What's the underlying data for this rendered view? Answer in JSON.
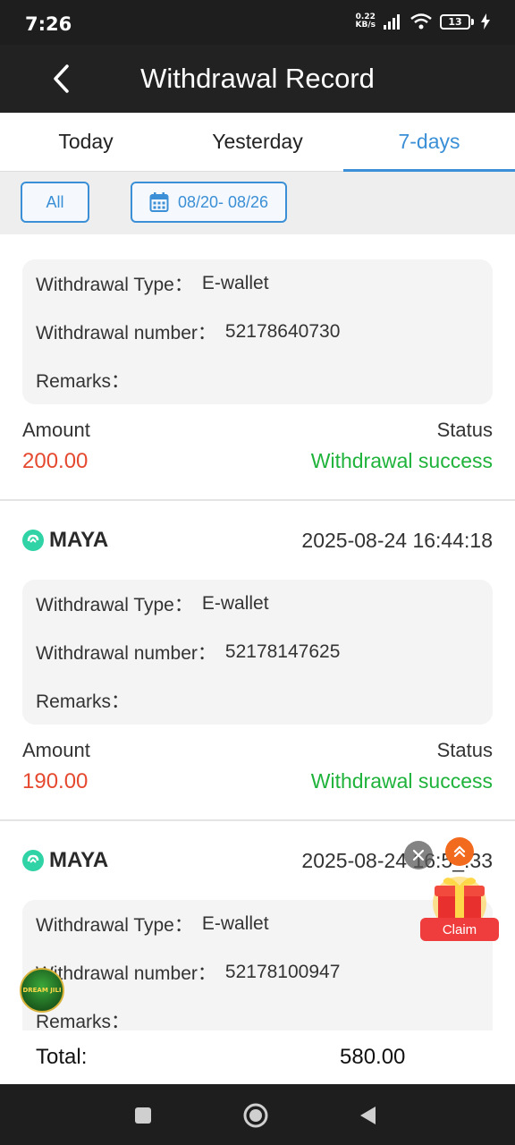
{
  "status_bar": {
    "time": "7:26",
    "net_speed_value": "0.22",
    "net_speed_unit": "KB/s",
    "battery": "13"
  },
  "header": {
    "title": "Withdrawal Record"
  },
  "tabs": [
    {
      "label": "Today",
      "active": false
    },
    {
      "label": "Yesterday",
      "active": false
    },
    {
      "label": "7-days",
      "active": true
    }
  ],
  "filter": {
    "all_label": "All",
    "date_range": "08/20- 08/26"
  },
  "labels": {
    "withdrawal_type": "Withdrawal Type：",
    "withdrawal_number": "Withdrawal number：",
    "remarks": "Remarks：",
    "amount": "Amount",
    "status": "Status"
  },
  "records": [
    {
      "brand": "",
      "datetime": "",
      "type": "E-wallet",
      "number": "52178640730",
      "remarks": "",
      "amount": "200.00",
      "status": "Withdrawal success"
    },
    {
      "brand": "MAYA",
      "datetime": "2025-08-24 16:44:18",
      "type": "E-wallet",
      "number": "52178147625",
      "remarks": "",
      "amount": "190.00",
      "status": "Withdrawal success"
    },
    {
      "brand": "MAYA",
      "datetime": "2025-08-24 16:5_:33",
      "type": "E-wallet",
      "number": "52178100947",
      "remarks": "",
      "amount": "",
      "status": ""
    }
  ],
  "total": {
    "label": "Total:",
    "value": "580.00"
  },
  "overlays": {
    "claim_label": "Claim",
    "badge_text": "DREAM JILI"
  },
  "colors": {
    "accent": "#3a8fd6",
    "amount": "#e5492f",
    "success": "#1fb33b",
    "header_bg": "#222222",
    "maya_green": "#2fd3a5"
  }
}
